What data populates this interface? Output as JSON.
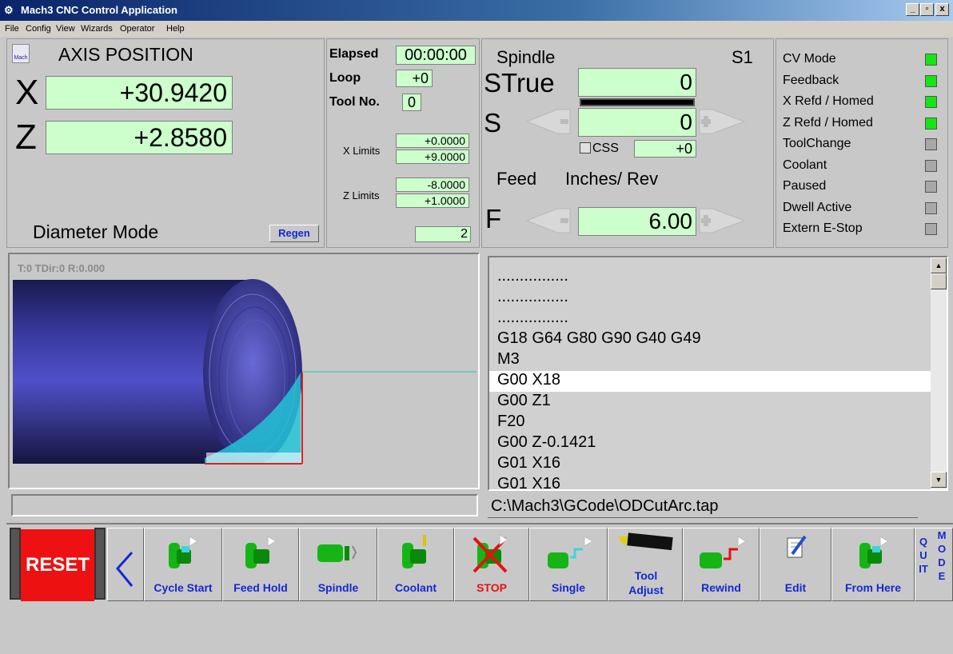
{
  "window": {
    "title": "Mach3 CNC Control Application",
    "controls": [
      "_",
      "❐",
      "x"
    ]
  },
  "menu": [
    "File",
    "Config",
    "View",
    "Wizards",
    "Operator",
    "Help"
  ],
  "axis": {
    "heading": "AXIS POSITION",
    "x_label": "X",
    "x_value": "+30.9420",
    "z_label": "Z",
    "z_value": "+2.8580",
    "mode": "Diameter Mode",
    "regen": "Regen"
  },
  "info": {
    "elapsed_label": "Elapsed",
    "elapsed": "00:00:00",
    "loop_label": "Loop",
    "loop": "+0",
    "tool_label": "Tool No.",
    "tool": "0",
    "xlimits_label": "X Limits",
    "xlim_min": "+0.0000",
    "xlim_max": "+9.0000",
    "zlimits_label": "Z Limits",
    "zlim_min": "-8.0000",
    "zlim_max": "+1.0000",
    "extra": "2"
  },
  "spindle": {
    "heading": "Spindle",
    "s_code": "S1",
    "strue_label": "STrue",
    "strue": "0",
    "s_label": "S",
    "s": "0",
    "css_label": "CSS",
    "css": "+0",
    "feed_label": "Feed",
    "feed_units": "Inches/ Rev",
    "f_label": "F",
    "f": "6.00"
  },
  "status": [
    {
      "label": "CV Mode",
      "state": "on"
    },
    {
      "label": "Feedback",
      "state": "on"
    },
    {
      "label": "X Refd / Homed",
      "state": "on"
    },
    {
      "label": "Z Refd / Homed",
      "state": "on"
    },
    {
      "label": "ToolChange",
      "state": "off"
    },
    {
      "label": "Coolant",
      "state": "off"
    },
    {
      "label": "Paused",
      "state": "off"
    },
    {
      "label": "Dwell Active",
      "state": "off"
    },
    {
      "label": "Extern E-Stop",
      "state": "off"
    }
  ],
  "toolpath": {
    "info": "T:0 TDir:0 R:0.000"
  },
  "gcode": {
    "lines": [
      "................",
      "................",
      "................",
      "G18 G64 G80 G90 G40 G49",
      "M3",
      "G00 X18",
      "G00 Z1",
      "F20",
      "G00 Z-0.1421",
      "G01 X16",
      "G01 X16"
    ],
    "current_index": 5,
    "file": "C:\\Mach3\\GCode\\ODCutArc.tap"
  },
  "buttons": {
    "reset": "RESET",
    "cycle_start": "Cycle Start",
    "feed_hold": "Feed Hold",
    "spindle": "Spindle",
    "coolant": "Coolant",
    "stop": "STOP",
    "single": "Single",
    "tool_adjust": "Tool Adjust",
    "rewind": "Rewind",
    "edit": "Edit",
    "from_here": "From Here",
    "quit": "QUIT",
    "mode": "MODE"
  },
  "colors": {
    "dro_bg": "#ccffcc",
    "led_on": "#14e614",
    "button_text": "#1428d2",
    "reset_bg": "#ee1111"
  }
}
